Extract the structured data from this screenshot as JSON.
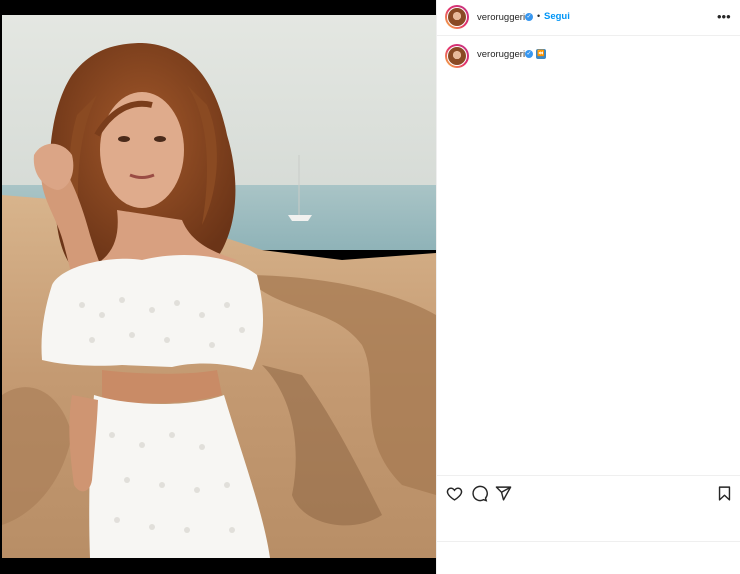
{
  "post": {
    "username": "veroruggeri",
    "separator": "•",
    "follow_label": "Segui",
    "more_icon": "more-options-icon",
    "verified_icon": "verified-badge-icon"
  },
  "caption": {
    "username": "veroruggeri",
    "emoji": "⏪"
  },
  "actions": {
    "like_icon": "heart-icon",
    "comment_icon": "comment-icon",
    "share_icon": "share-icon",
    "save_icon": "bookmark-icon"
  },
  "colors": {
    "link": "#0095f6",
    "verified": "#3897f0",
    "text": "#262626",
    "divider": "#efefef"
  }
}
